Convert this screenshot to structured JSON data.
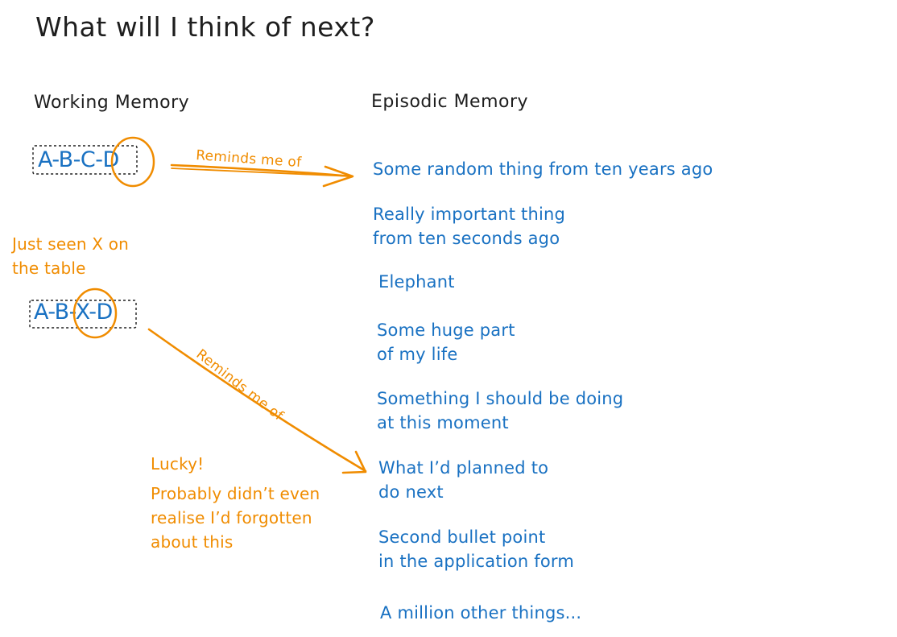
{
  "title": "What will I think of next?",
  "working_memory": {
    "heading": "Working Memory",
    "sequence_1": "A-B-C-D",
    "sequence_2": "A-B-X-D"
  },
  "episodic_memory": {
    "heading": "Episodic Memory",
    "items": [
      [
        "Some random thing from ten years ago"
      ],
      [
        "Really important thing",
        "from ten seconds ago"
      ],
      [
        "Elephant"
      ],
      [
        "Some huge part",
        "of my life"
      ],
      [
        "Something I should be doing",
        "at this moment"
      ],
      [
        "What I’d planned to",
        "do next"
      ],
      [
        "Second bullet point",
        "in the application form"
      ],
      [
        "A million other things..."
      ]
    ]
  },
  "annotations": {
    "reminds_1": "Reminds me of",
    "reminds_2": "Reminds me of",
    "just_seen": [
      "Just seen X on",
      "the table"
    ],
    "lucky": "Lucky!",
    "probably": [
      "Probably didn’t even",
      "realise I’d forgotten",
      "about this"
    ]
  },
  "colors": {
    "text": "#1e1e1e",
    "blue": "#1971c2",
    "orange": "#f08c00"
  }
}
